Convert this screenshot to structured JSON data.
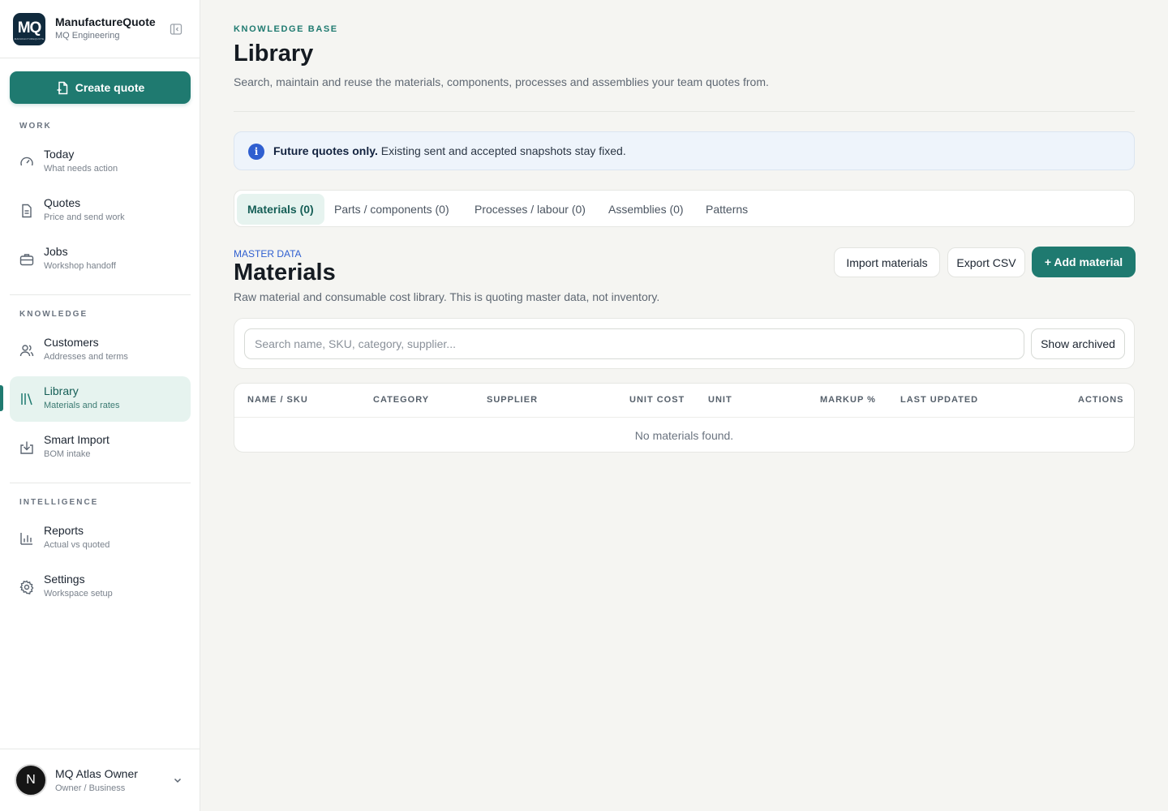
{
  "brand": {
    "logo_text": "MQ",
    "logo_subtext": "MANUFACTUREQUOTE",
    "name": "ManufactureQuote",
    "workspace": "MQ Engineering"
  },
  "sidebar": {
    "create_label": "Create quote",
    "sections": {
      "work": "WORK",
      "knowledge": "KNOWLEDGE",
      "intelligence": "INTELLIGENCE"
    },
    "items": [
      {
        "label": "Today",
        "sub": "What needs action",
        "icon": "gauge-icon"
      },
      {
        "label": "Quotes",
        "sub": "Price and send work",
        "icon": "document-icon"
      },
      {
        "label": "Jobs",
        "sub": "Workshop handoff",
        "icon": "briefcase-icon"
      },
      {
        "label": "Customers",
        "sub": "Addresses and terms",
        "icon": "users-icon"
      },
      {
        "label": "Library",
        "sub": "Materials and rates",
        "icon": "library-icon"
      },
      {
        "label": "Smart Import",
        "sub": "BOM intake",
        "icon": "import-icon"
      },
      {
        "label": "Reports",
        "sub": "Actual vs quoted",
        "icon": "bar-chart-icon"
      },
      {
        "label": "Settings",
        "sub": "Workspace setup",
        "icon": "gear-icon"
      }
    ],
    "active_item": "Library"
  },
  "user": {
    "initial": "N",
    "name": "MQ Atlas Owner",
    "role": "Owner / Business"
  },
  "header": {
    "eyebrow": "KNOWLEDGE BASE",
    "title": "Library",
    "subtitle": "Search, maintain and reuse the materials, components, processes and assemblies your team quotes from."
  },
  "banner": {
    "strong": "Future quotes only.",
    "text": " Existing sent and accepted snapshots stay fixed."
  },
  "tabs": [
    {
      "label": "Materials (0)",
      "active": true
    },
    {
      "label": "Parts / components (0)",
      "active": false
    },
    {
      "label": "Processes / labour (0)",
      "active": false
    },
    {
      "label": "Assemblies (0)",
      "active": false
    },
    {
      "label": "Patterns",
      "active": false
    }
  ],
  "section": {
    "eyebrow": "MASTER DATA",
    "title": "Materials",
    "subtitle": "Raw material and consumable cost library. This is quoting master data, not inventory.",
    "import_label": "Import materials",
    "export_label": "Export CSV",
    "add_label": "+ Add material"
  },
  "search": {
    "placeholder": "Search name, SKU, category, supplier...",
    "value": "",
    "archived_label": "Show archived"
  },
  "table": {
    "columns": [
      "NAME / SKU",
      "CATEGORY",
      "SUPPLIER",
      "UNIT COST",
      "UNIT",
      "MARKUP %",
      "LAST UPDATED",
      "ACTIONS"
    ],
    "rows": [],
    "empty_message": "No materials found."
  },
  "colors": {
    "accent": "#1f7a70",
    "active_bg": "#e6f3ef",
    "info_blue": "#2f5fd0",
    "logo_bg": "#102a3d"
  }
}
